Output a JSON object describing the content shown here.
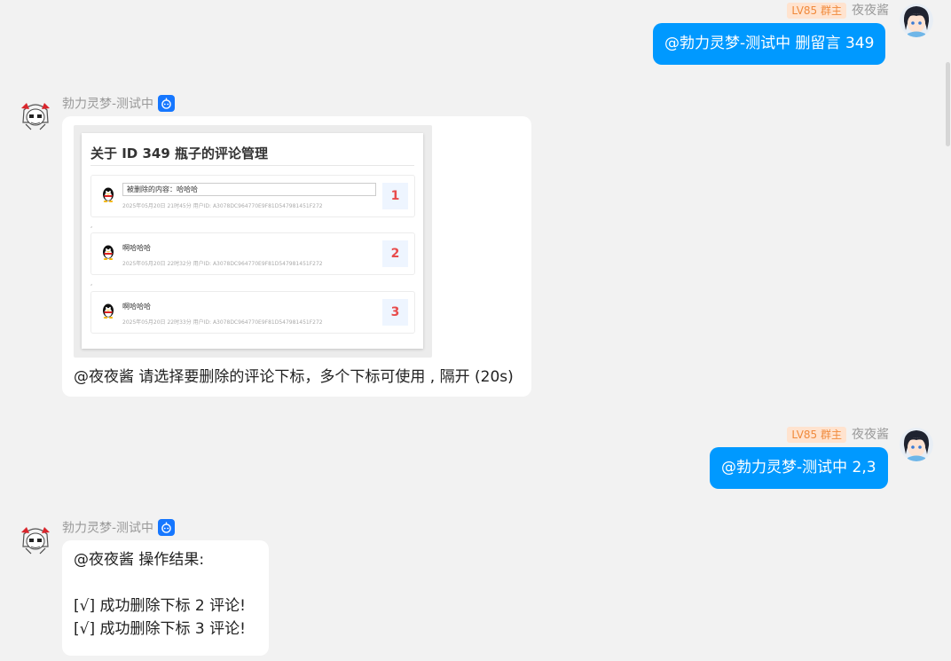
{
  "messages": {
    "m1": {
      "sender": "夜夜酱",
      "badge": "LV85 群主",
      "text": "@勃力灵梦-测试中 删留言 349"
    },
    "m2": {
      "sender": "勃力灵梦-测试中",
      "bot_icon": "robot-icon",
      "image": {
        "title": "关于 ID 349 瓶子的评论管理",
        "items": [
          {
            "content": "被删除的内容：哈哈哈",
            "meta": "2025年05月20日 21时45分    用户ID: A3078DC964770E9F81D547981451F272",
            "index": "1"
          },
          {
            "content": "啊哈哈哈",
            "meta": "2025年05月20日 22时32分    用户ID: A3078DC964770E9F81D547981451F272",
            "index": "2"
          },
          {
            "content": "啊哈哈哈",
            "meta": "2025年05月20日 22时33分    用户ID: A3078DC964770E9F81D547981451F272",
            "index": "3"
          }
        ]
      },
      "caption": "@夜夜酱 请选择要删除的评论下标，多个下标可使用 , 隔开 (20s)"
    },
    "m3": {
      "sender": "夜夜酱",
      "badge": "LV85 群主",
      "text": "@勃力灵梦-测试中 2,3"
    },
    "m4": {
      "sender": "勃力灵梦-测试中",
      "bot_icon": "robot-icon",
      "lines": [
        "@夜夜酱 操作结果:",
        "",
        "[√] 成功删除下标 2 评论!",
        "[√] 成功删除下标 3 评论!"
      ]
    }
  },
  "colors": {
    "background": "#f2f2f2",
    "my_bubble": "#0099ff",
    "bot_bubble": "#ffffff",
    "owner_badge_bg": "#ffe3cf",
    "owner_badge_text": "#f08a3c",
    "bot_badge": "#1677ff",
    "index_number": "#e84c4c"
  }
}
